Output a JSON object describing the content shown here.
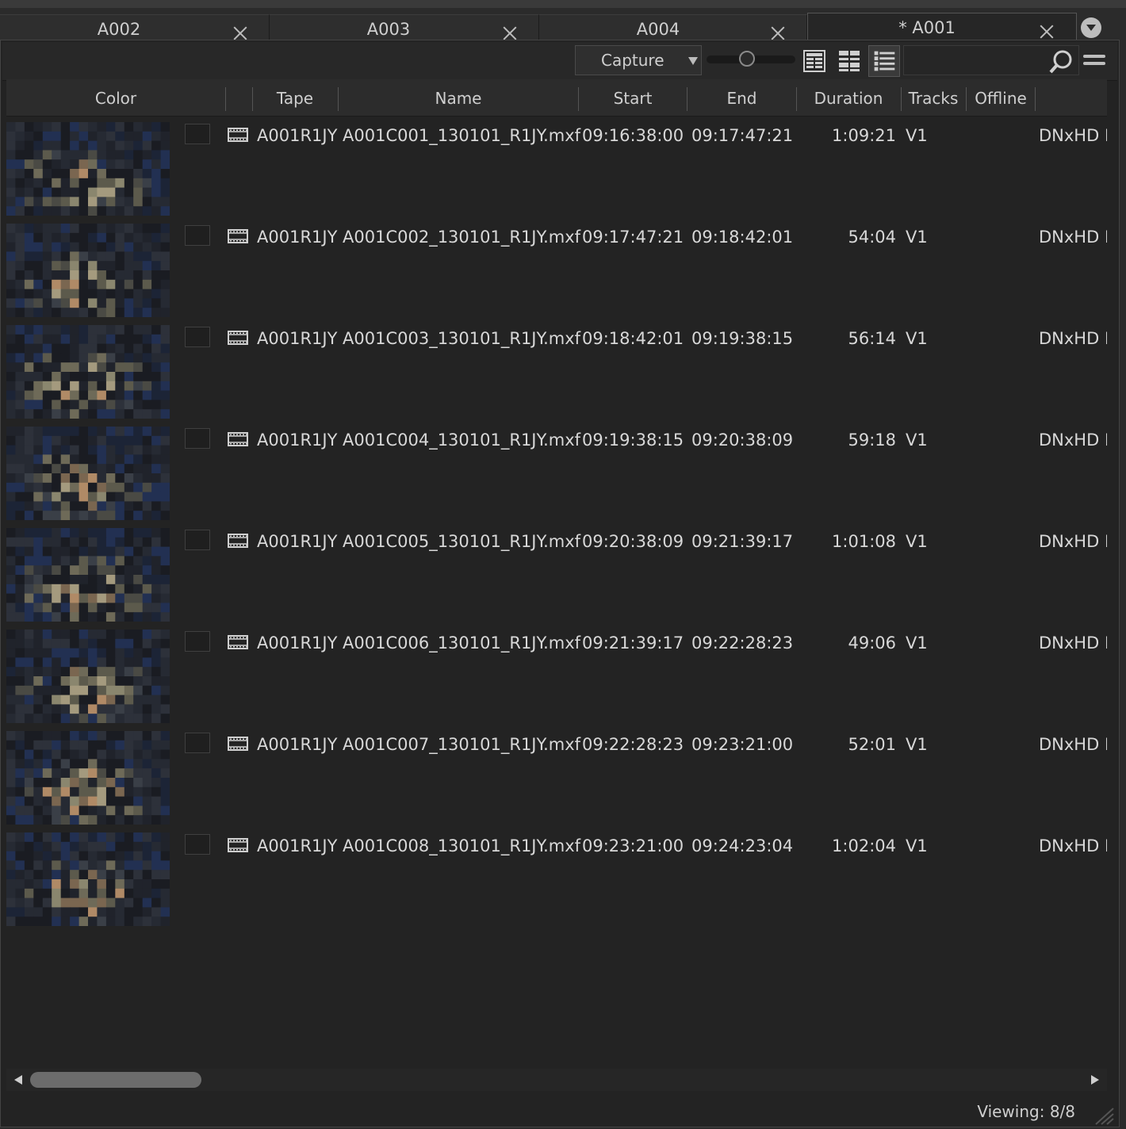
{
  "tabs": [
    {
      "label": "A002",
      "active": false
    },
    {
      "label": "A003",
      "active": false
    },
    {
      "label": "A004",
      "active": false
    },
    {
      "label": "* A001",
      "active": true
    }
  ],
  "toolbar": {
    "capture_label": "Capture",
    "search_placeholder": "",
    "zoom_level": 0.55
  },
  "columns": [
    "Color",
    "",
    "Tape",
    "Name",
    "Start",
    "End",
    "Duration",
    "Tracks",
    "Offline"
  ],
  "rows": [
    {
      "tape": "A001R1JY",
      "name": "A001C001_130101_R1JY.mxf",
      "start": "09:16:38:00",
      "end": "09:17:47:21",
      "duration": "1:09:21",
      "tracks": "V1",
      "format": "DNxHD I"
    },
    {
      "tape": "A001R1JY",
      "name": "A001C002_130101_R1JY.mxf",
      "start": "09:17:47:21",
      "end": "09:18:42:01",
      "duration": "54:04",
      "tracks": "V1",
      "format": "DNxHD I"
    },
    {
      "tape": "A001R1JY",
      "name": "A001C003_130101_R1JY.mxf",
      "start": "09:18:42:01",
      "end": "09:19:38:15",
      "duration": "56:14",
      "tracks": "V1",
      "format": "DNxHD I"
    },
    {
      "tape": "A001R1JY",
      "name": "A001C004_130101_R1JY.mxf",
      "start": "09:19:38:15",
      "end": "09:20:38:09",
      "duration": "59:18",
      "tracks": "V1",
      "format": "DNxHD I"
    },
    {
      "tape": "A001R1JY",
      "name": "A001C005_130101_R1JY.mxf",
      "start": "09:20:38:09",
      "end": "09:21:39:17",
      "duration": "1:01:08",
      "tracks": "V1",
      "format": "DNxHD I"
    },
    {
      "tape": "A001R1JY",
      "name": "A001C006_130101_R1JY.mxf",
      "start": "09:21:39:17",
      "end": "09:22:28:23",
      "duration": "49:06",
      "tracks": "V1",
      "format": "DNxHD I"
    },
    {
      "tape": "A001R1JY",
      "name": "A001C007_130101_R1JY.mxf",
      "start": "09:22:28:23",
      "end": "09:23:21:00",
      "duration": "52:01",
      "tracks": "V1",
      "format": "DNxHD I"
    },
    {
      "tape": "A001R1JY",
      "name": "A001C008_130101_R1JY.mxf",
      "start": "09:23:21:00",
      "end": "09:24:23:04",
      "duration": "1:02:04",
      "tracks": "V1",
      "format": "DNxHD I"
    }
  ],
  "status": {
    "viewing": "Viewing: 8/8"
  },
  "icons": {
    "tab_close": "close-icon",
    "tab_menu": "chevron-down-icon",
    "view_thumbnail": "grid-large-icon",
    "view_grid": "grid-small-icon",
    "view_list": "list-icon",
    "search": "search-icon",
    "options": "menu-icon",
    "clip": "film-clip-icon"
  }
}
